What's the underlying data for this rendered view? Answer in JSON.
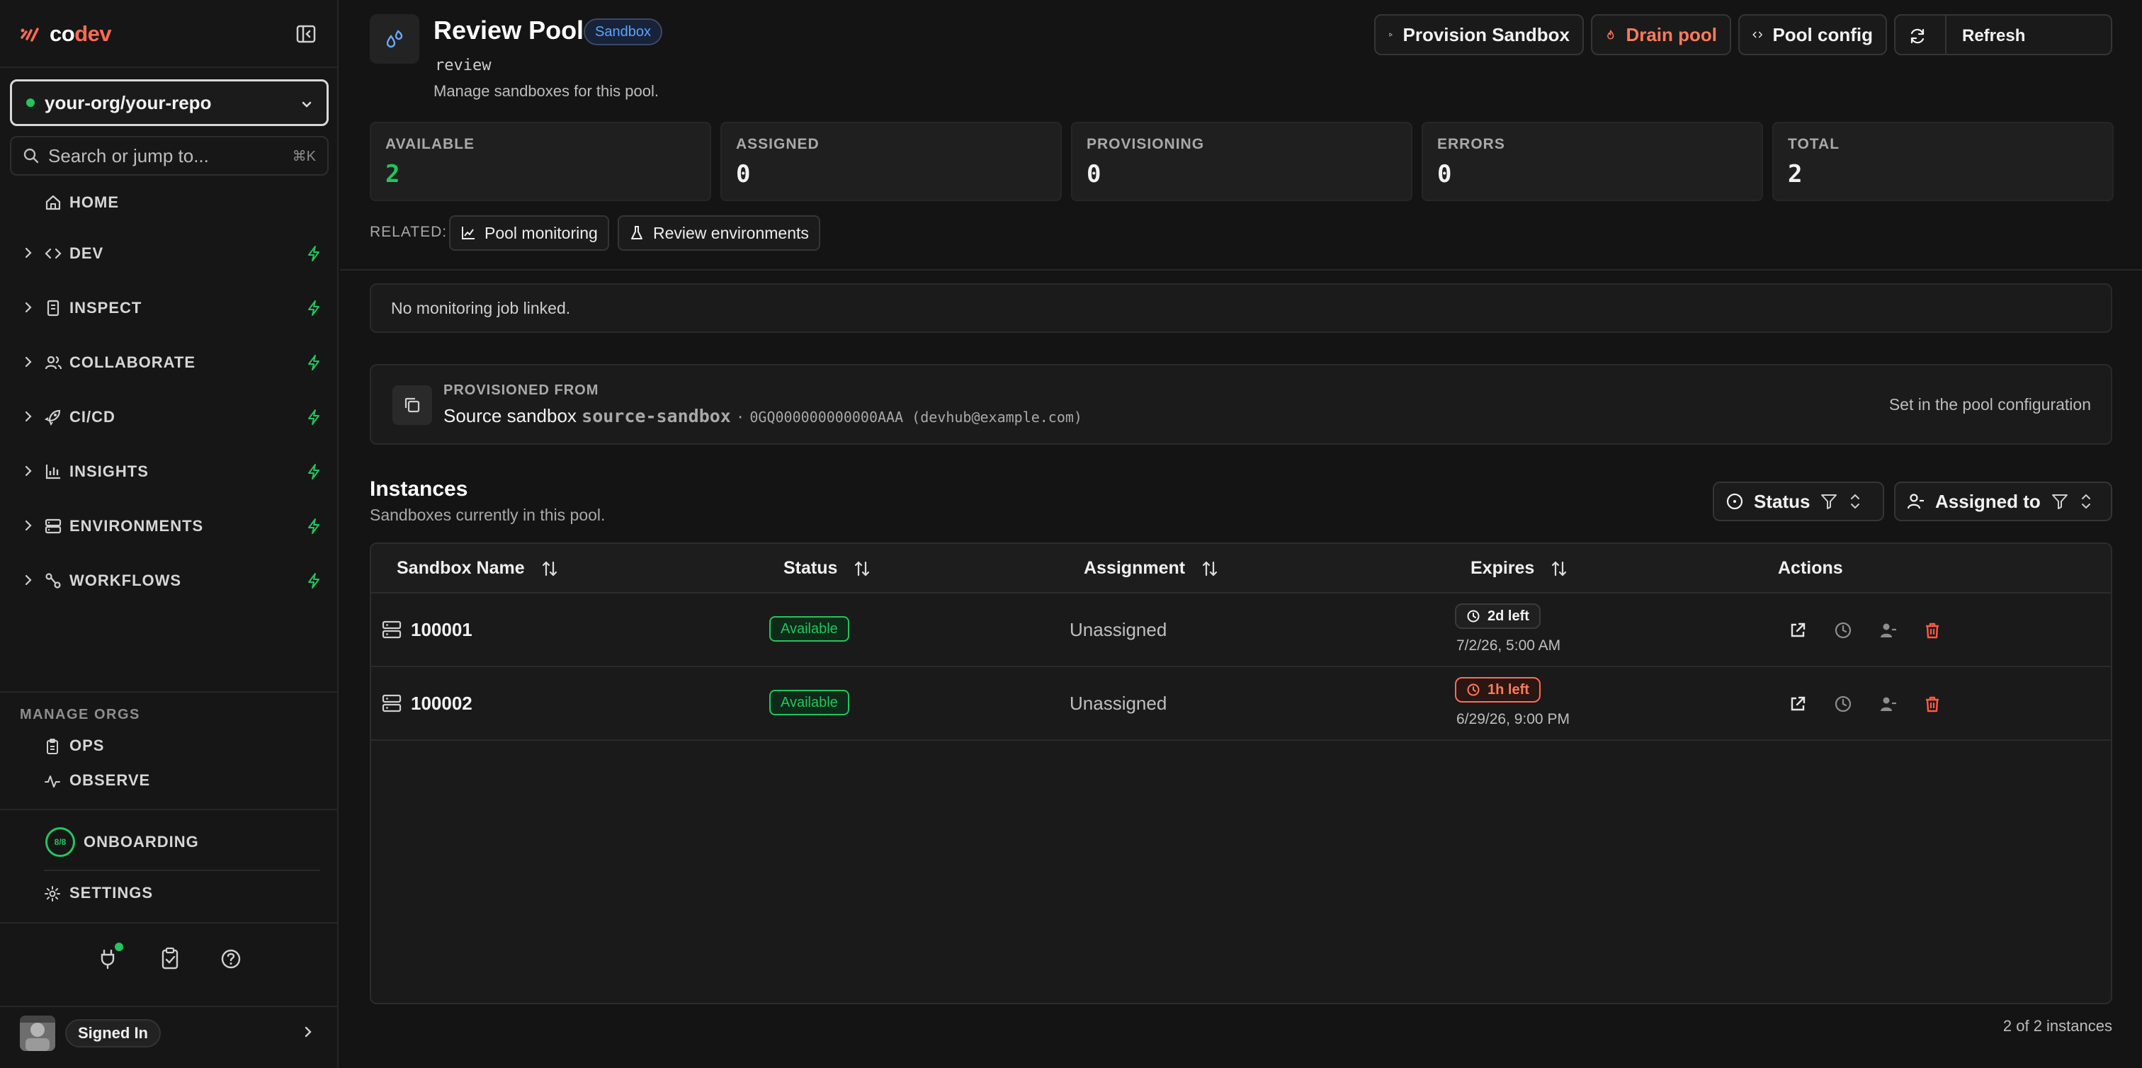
{
  "sidebar": {
    "logo": {
      "co": "co",
      "dev": "dev"
    },
    "repo_selector": "your-org/your-repo",
    "search": {
      "placeholder": "Search or jump to...",
      "shortcut": "⌘K"
    },
    "home": "HOME",
    "nav": [
      {
        "label": "DEV",
        "icon": "code-icon"
      },
      {
        "label": "INSPECT",
        "icon": "inspect-icon"
      },
      {
        "label": "COLLABORATE",
        "icon": "users-icon"
      },
      {
        "label": "CI/CD",
        "icon": "rocket-icon"
      },
      {
        "label": "INSIGHTS",
        "icon": "bar-chart-icon"
      },
      {
        "label": "ENVIRONMENTS",
        "icon": "server-icon"
      },
      {
        "label": "WORKFLOWS",
        "icon": "workflow-icon"
      }
    ],
    "manage_title": "MANAGE ORGS",
    "manage_items": [
      "OPS",
      "OBSERVE"
    ],
    "onboarding": {
      "label": "ONBOARDING",
      "progress": "8/8"
    },
    "settings": "SETTINGS",
    "user": {
      "status": "Signed In"
    }
  },
  "header": {
    "title": "Review Pool",
    "badge": "Sandbox",
    "slug": "review",
    "description": "Manage sandboxes for this pool.",
    "buttons": {
      "provision": "Provision Sandbox",
      "drain": "Drain pool",
      "config": "Pool config",
      "refresh": "Refresh"
    }
  },
  "stats": [
    {
      "label": "AVAILABLE",
      "value": "2"
    },
    {
      "label": "ASSIGNED",
      "value": "0"
    },
    {
      "label": "PROVISIONING",
      "value": "0"
    },
    {
      "label": "ERRORS",
      "value": "0"
    },
    {
      "label": "TOTAL",
      "value": "2"
    }
  ],
  "related": {
    "label": "RELATED:",
    "links": [
      "Pool monitoring",
      "Review environments"
    ]
  },
  "monitoring_notice": "No monitoring job linked.",
  "provisioned_from": {
    "title": "PROVISIONED FROM",
    "prefix": "Source sandbox",
    "name": "source-sandbox",
    "sep": "·",
    "details": "0GQ000000000000AAA (devhub@example.com)",
    "note": "Set in the pool configuration"
  },
  "instances": {
    "title": "Instances",
    "subtitle": "Sandboxes currently in this pool.",
    "filters": {
      "status": "Status",
      "assigned": "Assigned to"
    },
    "columns": [
      "Sandbox Name",
      "Status",
      "Assignment",
      "Expires",
      "Actions"
    ],
    "rows": [
      {
        "name": "100001",
        "status": "Available",
        "assignment": "Unassigned",
        "expires_badge": "2d left",
        "expires_date": "7/2/26, 5:00 AM",
        "warn": false
      },
      {
        "name": "100002",
        "status": "Available",
        "assignment": "Unassigned",
        "expires_badge": "1h left",
        "expires_date": "6/29/26, 9:00 PM",
        "warn": true
      }
    ],
    "count": "2 of 2 instances"
  },
  "colors": {
    "accent_green": "#22c55e",
    "danger": "#ff6b55",
    "badge_blue": "#5aa4ff"
  }
}
